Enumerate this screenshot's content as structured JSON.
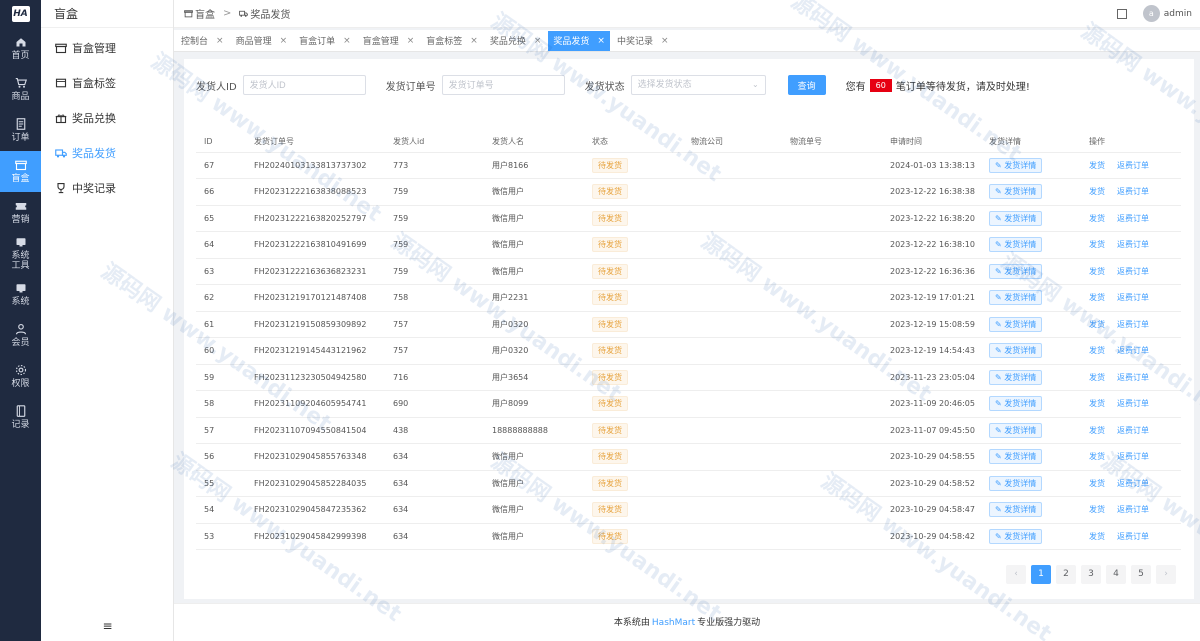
{
  "rail": {
    "logo": "HA",
    "items": [
      {
        "label": "首页",
        "icon": "home-icon"
      },
      {
        "label": "商品",
        "icon": "cart-icon"
      },
      {
        "label": "订单",
        "icon": "order-icon"
      },
      {
        "label": "盲盒",
        "icon": "box-icon"
      },
      {
        "label": "营销",
        "icon": "ticket-icon"
      },
      {
        "label": "系统\n工具",
        "icon": "tool-icon"
      },
      {
        "label": "系统",
        "icon": "system-icon"
      },
      {
        "label": "会员",
        "icon": "user-icon"
      },
      {
        "label": "权限",
        "icon": "gear-icon"
      },
      {
        "label": "记录",
        "icon": "record-icon"
      }
    ]
  },
  "submenu": {
    "title": "盲盒",
    "items": [
      {
        "label": "盲盒管理",
        "icon": "box-icon"
      },
      {
        "label": "盲盒标签",
        "icon": "tag-icon"
      },
      {
        "label": "奖品兑换",
        "icon": "gift-icon"
      },
      {
        "label": "奖品发货",
        "icon": "truck-icon"
      },
      {
        "label": "中奖记录",
        "icon": "trophy-icon"
      }
    ],
    "collapse_icon": "≡"
  },
  "header": {
    "crumb_root": "盲盒",
    "crumb_leaf": "奖品发货",
    "avatar_letter": "a",
    "username": "admin"
  },
  "tabs": [
    {
      "label": "控制台"
    },
    {
      "label": "商品管理"
    },
    {
      "label": "盲盒订单"
    },
    {
      "label": "盲盒管理"
    },
    {
      "label": "盲盒标签"
    },
    {
      "label": "奖品兑换"
    },
    {
      "label": "奖品发货"
    },
    {
      "label": "中奖记录"
    }
  ],
  "filters": {
    "shipper_id_label": "发货人ID",
    "shipper_id_placeholder": "发货人ID",
    "order_no_label": "发货订单号",
    "order_no_placeholder": "发货订单号",
    "status_label": "发货状态",
    "status_placeholder": "选择发货状态",
    "search_label": "查询",
    "pending_prefix": "您有",
    "pending_count": "60",
    "pending_suffix": "笔订单等待发货，请及时处理!"
  },
  "table": {
    "headers": [
      "ID",
      "发货订单号",
      "发货人id",
      "发货人名",
      "状态",
      "物流公司",
      "物流单号",
      "申请时间",
      "发货详情",
      "操作"
    ],
    "detail_label": "发货详情",
    "op_ship": "发货",
    "op_return": "返费订单",
    "rows": [
      {
        "id": "67",
        "order": "FH20240103133813737302",
        "uid": "773",
        "name": "用户8166",
        "status": "待发货",
        "company": "",
        "tracking": "",
        "time": "2024-01-03 13:38:13"
      },
      {
        "id": "66",
        "order": "FH20231222163838088523",
        "uid": "759",
        "name": "微信用户",
        "status": "待发货",
        "company": "",
        "tracking": "",
        "time": "2023-12-22 16:38:38"
      },
      {
        "id": "65",
        "order": "FH20231222163820252797",
        "uid": "759",
        "name": "微信用户",
        "status": "待发货",
        "company": "",
        "tracking": "",
        "time": "2023-12-22 16:38:20"
      },
      {
        "id": "64",
        "order": "FH20231222163810491699",
        "uid": "759",
        "name": "微信用户",
        "status": "待发货",
        "company": "",
        "tracking": "",
        "time": "2023-12-22 16:38:10"
      },
      {
        "id": "63",
        "order": "FH20231222163636823231",
        "uid": "759",
        "name": "微信用户",
        "status": "待发货",
        "company": "",
        "tracking": "",
        "time": "2023-12-22 16:36:36"
      },
      {
        "id": "62",
        "order": "FH20231219170121487408",
        "uid": "758",
        "name": "用户2231",
        "status": "待发货",
        "company": "",
        "tracking": "",
        "time": "2023-12-19 17:01:21"
      },
      {
        "id": "61",
        "order": "FH20231219150859309892",
        "uid": "757",
        "name": "用户0320",
        "status": "待发货",
        "company": "",
        "tracking": "",
        "time": "2023-12-19 15:08:59"
      },
      {
        "id": "60",
        "order": "FH20231219145443121962",
        "uid": "757",
        "name": "用户0320",
        "status": "待发货",
        "company": "",
        "tracking": "",
        "time": "2023-12-19 14:54:43"
      },
      {
        "id": "59",
        "order": "FH20231123230504942580",
        "uid": "716",
        "name": "用户3654",
        "status": "待发货",
        "company": "",
        "tracking": "",
        "time": "2023-11-23 23:05:04"
      },
      {
        "id": "58",
        "order": "FH20231109204605954741",
        "uid": "690",
        "name": "用户8099",
        "status": "待发货",
        "company": "",
        "tracking": "",
        "time": "2023-11-09 20:46:05"
      },
      {
        "id": "57",
        "order": "FH20231107094550841504",
        "uid": "438",
        "name": "18888888888",
        "status": "待发货",
        "company": "",
        "tracking": "",
        "time": "2023-11-07 09:45:50"
      },
      {
        "id": "56",
        "order": "FH20231029045855763348",
        "uid": "634",
        "name": "微信用户",
        "status": "待发货",
        "company": "",
        "tracking": "",
        "time": "2023-10-29 04:58:55"
      },
      {
        "id": "55",
        "order": "FH20231029045852284035",
        "uid": "634",
        "name": "微信用户",
        "status": "待发货",
        "company": "",
        "tracking": "",
        "time": "2023-10-29 04:58:52"
      },
      {
        "id": "54",
        "order": "FH20231029045847235362",
        "uid": "634",
        "name": "微信用户",
        "status": "待发货",
        "company": "",
        "tracking": "",
        "time": "2023-10-29 04:58:47"
      },
      {
        "id": "53",
        "order": "FH20231029045842999398",
        "uid": "634",
        "name": "微信用户",
        "status": "待发货",
        "company": "",
        "tracking": "",
        "time": "2023-10-29 04:58:42"
      }
    ]
  },
  "pagination": {
    "prev": "‹",
    "pages": [
      "1",
      "2",
      "3",
      "4",
      "5"
    ],
    "current": "1",
    "next": "›"
  },
  "footer": {
    "prefix": "本系统由",
    "brand": "HashMart",
    "suffix": "专业版强力驱动"
  },
  "watermark": {
    "text": "源码网 www.yuandi.net"
  },
  "colors": {
    "primary": "#409eff",
    "rail_bg": "#1f2a40",
    "pending_badge": "#e60012",
    "status_warning": "#e6a23c"
  }
}
